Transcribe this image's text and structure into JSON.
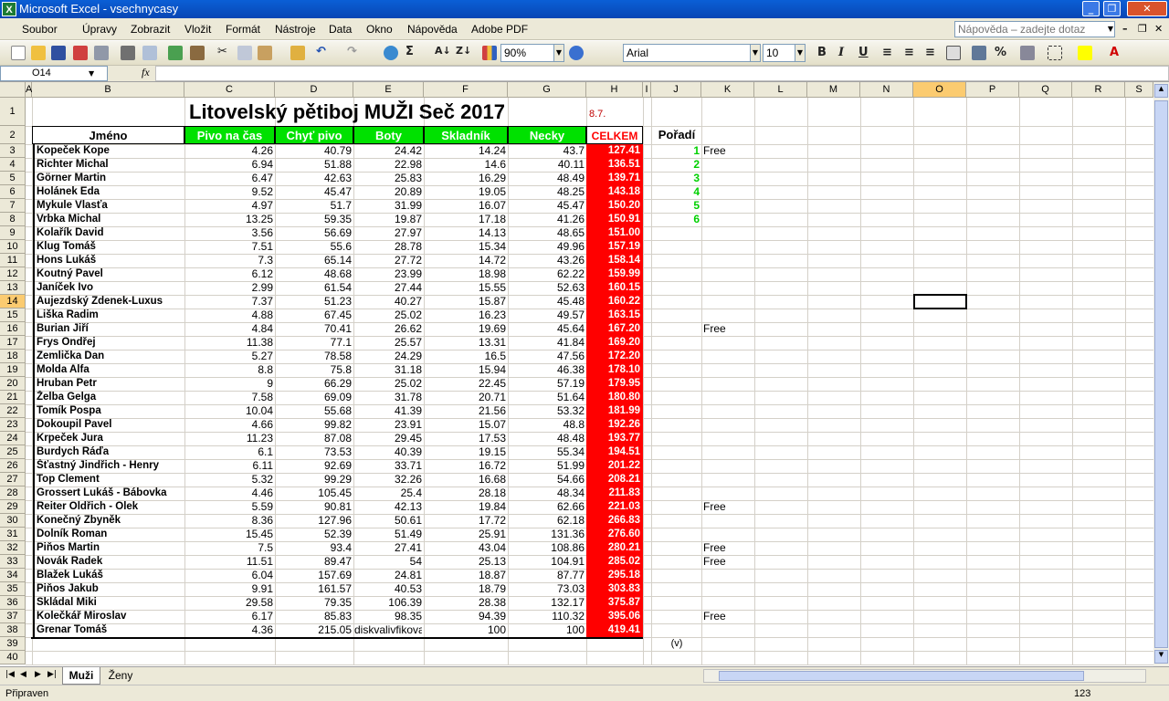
{
  "window": {
    "title": "Microsoft Excel - vsechnycasy",
    "app_icon": "X"
  },
  "menu": [
    "Soubor",
    "Úpravy",
    "Zobrazit",
    "Vložit",
    "Formát",
    "Nástroje",
    "Data",
    "Okno",
    "Nápověda",
    "Adobe PDF"
  ],
  "help": {
    "placeholder": "Nápověda – zadejte dotaz"
  },
  "toolbar": {
    "zoom": "90%",
    "font": "Arial",
    "size": "10",
    "bold": "B",
    "italic": "I",
    "underline": "U",
    "percent": "%"
  },
  "formula": {
    "cell_ref": "O14",
    "fx": "fx",
    "value": ""
  },
  "columns": [
    "A",
    "B",
    "C",
    "D",
    "E",
    "F",
    "G",
    "H",
    "I",
    "J",
    "K",
    "L",
    "M",
    "N",
    "O",
    "P",
    "Q",
    "R",
    "S"
  ],
  "selected_col": "O",
  "selected_row": "14",
  "sheet": {
    "title": "Litovelský pětiboj  MUŽI   Seč 2017",
    "date": "8.7.",
    "headers": {
      "name": "Jméno",
      "c": "Pivo na čas",
      "d": "Chyť pivo",
      "e": "Boty",
      "f": "Skladník",
      "g": "Necky",
      "h": "CELKEM",
      "j": "Pořadí"
    },
    "rows": [
      {
        "name": "Kopeček Kope",
        "c": "4.26",
        "d": "40.79",
        "e": "24.42",
        "f": "14.24",
        "g": "43.7",
        "h": "127.41",
        "j": "1",
        "k": "Free"
      },
      {
        "name": "Richter Michal",
        "c": "6.94",
        "d": "51.88",
        "e": "22.98",
        "f": "14.6",
        "g": "40.11",
        "h": "136.51",
        "j": "2",
        "k": ""
      },
      {
        "name": "Görner Martin",
        "c": "6.47",
        "d": "42.63",
        "e": "25.83",
        "f": "16.29",
        "g": "48.49",
        "h": "139.71",
        "j": "3",
        "k": ""
      },
      {
        "name": "Holánek Eda",
        "c": "9.52",
        "d": "45.47",
        "e": "20.89",
        "f": "19.05",
        "g": "48.25",
        "h": "143.18",
        "j": "4",
        "k": ""
      },
      {
        "name": "Mykule Vlasťa",
        "c": "4.97",
        "d": "51.7",
        "e": "31.99",
        "f": "16.07",
        "g": "45.47",
        "h": "150.20",
        "j": "5",
        "k": ""
      },
      {
        "name": "Vrbka Michal",
        "c": "13.25",
        "d": "59.35",
        "e": "19.87",
        "f": "17.18",
        "g": "41.26",
        "h": "150.91",
        "j": "6",
        "k": ""
      },
      {
        "name": "Kolařík David",
        "c": "3.56",
        "d": "56.69",
        "e": "27.97",
        "f": "14.13",
        "g": "48.65",
        "h": "151.00",
        "j": "",
        "k": ""
      },
      {
        "name": "Klug Tomáš",
        "c": "7.51",
        "d": "55.6",
        "e": "28.78",
        "f": "15.34",
        "g": "49.96",
        "h": "157.19",
        "j": "",
        "k": ""
      },
      {
        "name": "Hons Lukáš",
        "c": "7.3",
        "d": "65.14",
        "e": "27.72",
        "f": "14.72",
        "g": "43.26",
        "h": "158.14",
        "j": "",
        "k": ""
      },
      {
        "name": "Koutný Pavel",
        "c": "6.12",
        "d": "48.68",
        "e": "23.99",
        "f": "18.98",
        "g": "62.22",
        "h": "159.99",
        "j": "",
        "k": ""
      },
      {
        "name": "Janíček Ivo",
        "c": "2.99",
        "d": "61.54",
        "e": "27.44",
        "f": "15.55",
        "g": "52.63",
        "h": "160.15",
        "j": "",
        "k": ""
      },
      {
        "name": "Aujezdský Zdenek-Luxus",
        "c": "7.37",
        "d": "51.23",
        "e": "40.27",
        "f": "15.87",
        "g": "45.48",
        "h": "160.22",
        "j": "",
        "k": ""
      },
      {
        "name": "Liška Radim",
        "c": "4.88",
        "d": "67.45",
        "e": "25.02",
        "f": "16.23",
        "g": "49.57",
        "h": "163.15",
        "j": "",
        "k": ""
      },
      {
        "name": "Burian Jiří",
        "c": "4.84",
        "d": "70.41",
        "e": "26.62",
        "f": "19.69",
        "g": "45.64",
        "h": "167.20",
        "j": "",
        "k": "Free"
      },
      {
        "name": "Frys Ondřej",
        "c": "11.38",
        "d": "77.1",
        "e": "25.57",
        "f": "13.31",
        "g": "41.84",
        "h": "169.20",
        "j": "",
        "k": ""
      },
      {
        "name": "Zemlička Dan",
        "c": "5.27",
        "d": "78.58",
        "e": "24.29",
        "f": "16.5",
        "g": "47.56",
        "h": "172.20",
        "j": "",
        "k": ""
      },
      {
        "name": "Molda Alfa",
        "c": "8.8",
        "d": "75.8",
        "e": "31.18",
        "f": "15.94",
        "g": "46.38",
        "h": "178.10",
        "j": "",
        "k": ""
      },
      {
        "name": "Hruban Petr",
        "c": "9",
        "d": "66.29",
        "e": "25.02",
        "f": "22.45",
        "g": "57.19",
        "h": "179.95",
        "j": "",
        "k": ""
      },
      {
        "name": "Želba Gelga",
        "c": "7.58",
        "d": "69.09",
        "e": "31.78",
        "f": "20.71",
        "g": "51.64",
        "h": "180.80",
        "j": "",
        "k": ""
      },
      {
        "name": "Tomík Pospa",
        "c": "10.04",
        "d": "55.68",
        "e": "41.39",
        "f": "21.56",
        "g": "53.32",
        "h": "181.99",
        "j": "",
        "k": ""
      },
      {
        "name": "Dokoupil Pavel",
        "c": "4.66",
        "d": "99.82",
        "e": "23.91",
        "f": "15.07",
        "g": "48.8",
        "h": "192.26",
        "j": "",
        "k": ""
      },
      {
        "name": "Krpeček Jura",
        "c": "11.23",
        "d": "87.08",
        "e": "29.45",
        "f": "17.53",
        "g": "48.48",
        "h": "193.77",
        "j": "",
        "k": ""
      },
      {
        "name": "Burdych Ráďa",
        "c": "6.1",
        "d": "73.53",
        "e": "40.39",
        "f": "19.15",
        "g": "55.34",
        "h": "194.51",
        "j": "",
        "k": ""
      },
      {
        "name": "Šťastný Jindřich - Henry",
        "c": "6.11",
        "d": "92.69",
        "e": "33.71",
        "f": "16.72",
        "g": "51.99",
        "h": "201.22",
        "j": "",
        "k": ""
      },
      {
        "name": "Top Clement",
        "c": "5.32",
        "d": "99.29",
        "e": "32.26",
        "f": "16.68",
        "g": "54.66",
        "h": "208.21",
        "j": "",
        "k": ""
      },
      {
        "name": "Grossert Lukáš - Bábovka",
        "c": "4.46",
        "d": "105.45",
        "e": "25.4",
        "f": "28.18",
        "g": "48.34",
        "h": "211.83",
        "j": "",
        "k": ""
      },
      {
        "name": "Reiter Oldřich - Olek",
        "c": "5.59",
        "d": "90.81",
        "e": "42.13",
        "f": "19.84",
        "g": "62.66",
        "h": "221.03",
        "j": "",
        "k": "Free"
      },
      {
        "name": "Konečný Zbyněk",
        "c": "8.36",
        "d": "127.96",
        "e": "50.61",
        "f": "17.72",
        "g": "62.18",
        "h": "266.83",
        "j": "",
        "k": ""
      },
      {
        "name": "Dolník Roman",
        "c": "15.45",
        "d": "52.39",
        "e": "51.49",
        "f": "25.91",
        "g": "131.36",
        "h": "276.60",
        "j": "",
        "k": ""
      },
      {
        "name": "Piňos Martin",
        "c": "7.5",
        "d": "93.4",
        "e": "27.41",
        "f": "43.04",
        "g": "108.86",
        "h": "280.21",
        "j": "",
        "k": "Free"
      },
      {
        "name": "Novák Radek",
        "c": "11.51",
        "d": "89.47",
        "e": "54",
        "f": "25.13",
        "g": "104.91",
        "h": "285.02",
        "j": "",
        "k": "Free"
      },
      {
        "name": "Blažek Lukáš",
        "c": "6.04",
        "d": "157.69",
        "e": "24.81",
        "f": "18.87",
        "g": "87.77",
        "h": "295.18",
        "j": "",
        "k": ""
      },
      {
        "name": "Piňos Jakub",
        "c": "9.91",
        "d": "161.57",
        "e": "40.53",
        "f": "18.79",
        "g": "73.03",
        "h": "303.83",
        "j": "",
        "k": ""
      },
      {
        "name": "Skládal Miki",
        "c": "29.58",
        "d": "79.35",
        "e": "106.39",
        "f": "28.38",
        "g": "132.17",
        "h": "375.87",
        "j": "",
        "k": ""
      },
      {
        "name": "Kolečkář Miroslav",
        "c": "6.17",
        "d": "85.83",
        "e": "98.35",
        "f": "94.39",
        "g": "110.32",
        "h": "395.06",
        "j": "",
        "k": "Free"
      },
      {
        "name": "Grenar Tomáš",
        "c": "4.36",
        "d": "215.05",
        "e": "diskvalivfikova",
        "f": "100",
        "g": "100",
        "h": "419.41",
        "j": "",
        "k": ""
      }
    ],
    "note_v": "(v)"
  },
  "tabs": [
    "Muži",
    "Ženy"
  ],
  "status": {
    "left": "Připraven",
    "right": "123"
  },
  "colors": {
    "green": "#00e100",
    "red": "#ff0000",
    "rank": "#00d000",
    "selection": "#fbcb70"
  }
}
